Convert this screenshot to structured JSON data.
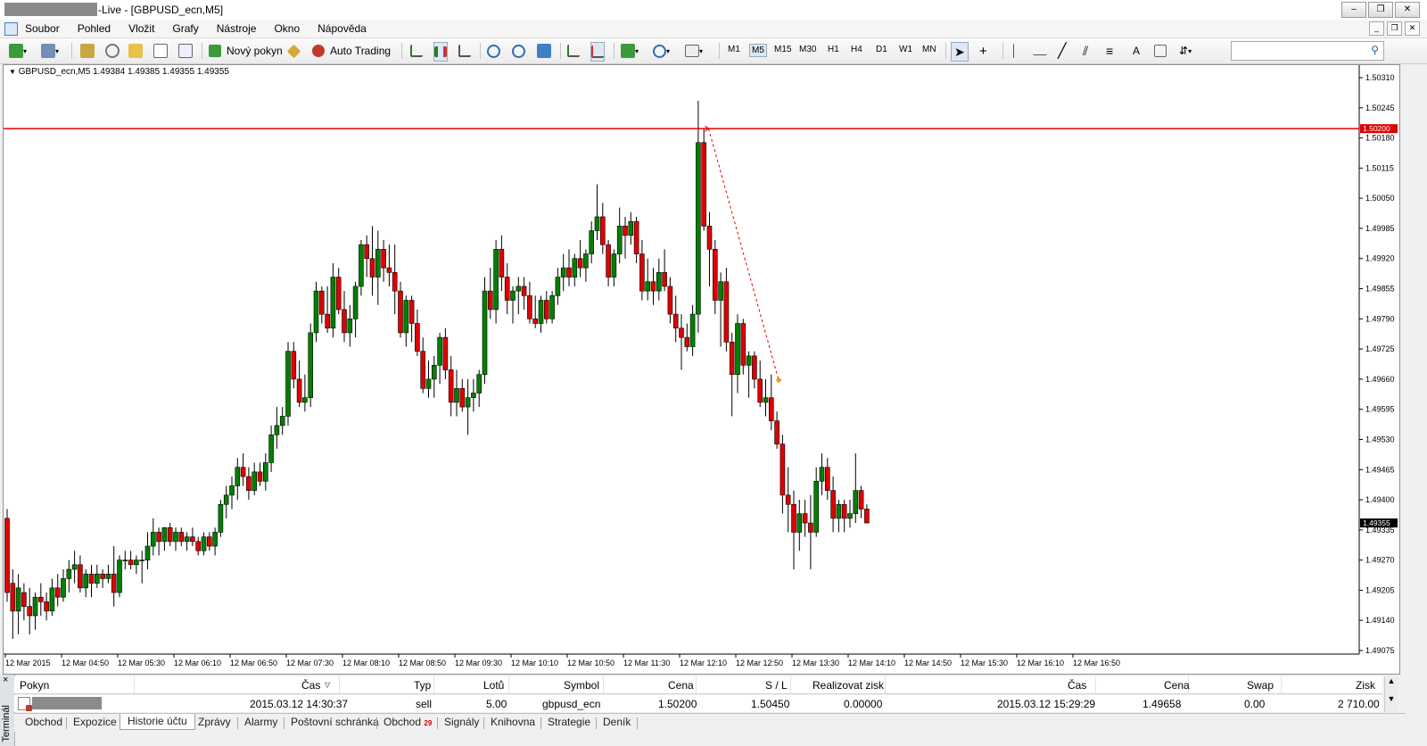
{
  "window": {
    "title_suffix": "-Live - [GBPUSD_ecn,M5]",
    "buttons": [
      "–",
      "❐",
      "✕"
    ]
  },
  "menu": {
    "items": [
      "Soubor",
      "Pohled",
      "Vložit",
      "Grafy",
      "Nástroje",
      "Okno",
      "Nápověda"
    ],
    "mdi_buttons": [
      "_",
      "❐",
      "✕"
    ]
  },
  "toolbar": {
    "new_order": "Nový pokyn",
    "auto_trading": "Auto Trading",
    "timeframes": [
      "M1",
      "M5",
      "M15",
      "M30",
      "H1",
      "H4",
      "D1",
      "W1",
      "MN"
    ],
    "active_timeframe": "M5",
    "search_placeholder": ""
  },
  "chart": {
    "header": "GBPUSD_ecn,M5  1.49384 1.49385 1.49355 1.49355",
    "hline_label": "1.50200",
    "bid_label": "1.49355",
    "colors": {
      "bull": "#008000",
      "bear": "#e00000",
      "line": "#e00000"
    },
    "price_ticks": [
      "1.50310",
      "1.50245",
      "1.50180",
      "1.50115",
      "1.50050",
      "1.49985",
      "1.49920",
      "1.49855",
      "1.49790",
      "1.49725",
      "1.49660",
      "1.49595",
      "1.49530",
      "1.49465",
      "1.49400",
      "1.49335",
      "1.49270",
      "1.49205",
      "1.49140",
      "1.49075"
    ],
    "time_ticks": [
      "12 Mar 2015",
      "12 Mar 04:50",
      "12 Mar 05:30",
      "12 Mar 06:10",
      "12 Mar 06:50",
      "12 Mar 07:30",
      "12 Mar 08:10",
      "12 Mar 08:50",
      "12 Mar 09:30",
      "12 Mar 10:10",
      "12 Mar 10:50",
      "12 Mar 11:30",
      "12 Mar 12:10",
      "12 Mar 12:50",
      "12 Mar 13:30",
      "12 Mar 14:10",
      "12 Mar 14:50",
      "12 Mar 15:30",
      "12 Mar 16:10",
      "12 Mar 16:50"
    ]
  },
  "chart_data": {
    "type": "candlestick",
    "symbol": "GBPUSD_ecn",
    "timeframe": "M5",
    "ylim": [
      1.49075,
      1.5031
    ],
    "horizontal_line": 1.502,
    "trade": {
      "open_price": 1.502,
      "close_price": 1.49658,
      "open_time": "2015.03.12 14:30:37",
      "close_time": "2015.03.12 15:29:29"
    },
    "ohlc": [
      [
        1.4936,
        1.4938,
        1.4918,
        1.492
      ],
      [
        1.4922,
        1.4925,
        1.491,
        1.4916
      ],
      [
        1.4916,
        1.4924,
        1.4911,
        1.4921
      ],
      [
        1.492,
        1.4922,
        1.4914,
        1.4917
      ],
      [
        1.4917,
        1.4921,
        1.4911,
        1.4915
      ],
      [
        1.4915,
        1.492,
        1.4912,
        1.4919
      ],
      [
        1.4919,
        1.4922,
        1.4915,
        1.4918
      ],
      [
        1.4918,
        1.492,
        1.4914,
        1.4916
      ],
      [
        1.4916,
        1.4923,
        1.4915,
        1.4921
      ],
      [
        1.4921,
        1.4924,
        1.4917,
        1.4919
      ],
      [
        1.4919,
        1.4925,
        1.4918,
        1.4923
      ],
      [
        1.4923,
        1.4927,
        1.492,
        1.4925
      ],
      [
        1.4925,
        1.4929,
        1.4922,
        1.4926
      ],
      [
        1.4926,
        1.4928,
        1.492,
        1.4921
      ],
      [
        1.4921,
        1.4925,
        1.4919,
        1.4924
      ],
      [
        1.4924,
        1.4926,
        1.4919,
        1.4922
      ],
      [
        1.4922,
        1.4926,
        1.4921,
        1.4924
      ],
      [
        1.4924,
        1.4925,
        1.4921,
        1.4923
      ],
      [
        1.4923,
        1.4926,
        1.4922,
        1.4924
      ],
      [
        1.4924,
        1.493,
        1.4917,
        1.492
      ],
      [
        1.492,
        1.4928,
        1.4919,
        1.4927
      ],
      [
        1.4927,
        1.4929,
        1.4925,
        1.4927
      ],
      [
        1.4927,
        1.4929,
        1.4925,
        1.4926
      ],
      [
        1.4926,
        1.4928,
        1.4924,
        1.4927
      ],
      [
        1.4927,
        1.4929,
        1.4922,
        1.4927
      ],
      [
        1.4927,
        1.4933,
        1.4925,
        1.493
      ],
      [
        1.493,
        1.4936,
        1.4928,
        1.4933
      ],
      [
        1.4933,
        1.4934,
        1.4928,
        1.4931
      ],
      [
        1.4931,
        1.4934,
        1.4929,
        1.4934
      ],
      [
        1.4934,
        1.4935,
        1.493,
        1.4931
      ],
      [
        1.4931,
        1.4934,
        1.4929,
        1.4933
      ],
      [
        1.4933,
        1.4934,
        1.493,
        1.4931
      ],
      [
        1.4931,
        1.4933,
        1.4929,
        1.4932
      ],
      [
        1.4932,
        1.4934,
        1.493,
        1.4931
      ],
      [
        1.4931,
        1.4932,
        1.4928,
        1.4929
      ],
      [
        1.4929,
        1.4933,
        1.4928,
        1.4932
      ],
      [
        1.4932,
        1.4933,
        1.4929,
        1.493
      ],
      [
        1.493,
        1.4934,
        1.4928,
        1.4933
      ],
      [
        1.4933,
        1.494,
        1.4932,
        1.4939
      ],
      [
        1.4939,
        1.4943,
        1.4936,
        1.4941
      ],
      [
        1.4941,
        1.4945,
        1.4938,
        1.4943
      ],
      [
        1.4943,
        1.4949,
        1.494,
        1.4947
      ],
      [
        1.4947,
        1.495,
        1.4943,
        1.4945
      ],
      [
        1.4945,
        1.4947,
        1.494,
        1.4942
      ],
      [
        1.4942,
        1.4948,
        1.4941,
        1.4946
      ],
      [
        1.4946,
        1.4948,
        1.4943,
        1.4944
      ],
      [
        1.4944,
        1.495,
        1.4942,
        1.4948
      ],
      [
        1.4948,
        1.4956,
        1.4946,
        1.4954
      ],
      [
        1.4954,
        1.496,
        1.4951,
        1.4956
      ],
      [
        1.4956,
        1.496,
        1.4954,
        1.4958
      ],
      [
        1.4958,
        1.4974,
        1.4956,
        1.4972
      ],
      [
        1.4972,
        1.4974,
        1.4964,
        1.4966
      ],
      [
        1.4966,
        1.497,
        1.496,
        1.4961
      ],
      [
        1.4961,
        1.4967,
        1.4959,
        1.4962
      ],
      [
        1.4962,
        1.4978,
        1.496,
        1.4976
      ],
      [
        1.4976,
        1.4987,
        1.4974,
        1.4985
      ],
      [
        1.4985,
        1.4986,
        1.4978,
        1.498
      ],
      [
        1.498,
        1.4986,
        1.4976,
        1.4977
      ],
      [
        1.4977,
        1.4991,
        1.4975,
        1.4988
      ],
      [
        1.4988,
        1.499,
        1.498,
        1.4981
      ],
      [
        1.4981,
        1.4985,
        1.4974,
        1.4976
      ],
      [
        1.4976,
        1.4982,
        1.4973,
        1.4979
      ],
      [
        1.4979,
        1.4987,
        1.4975,
        1.4986
      ],
      [
        1.4986,
        1.4996,
        1.4984,
        1.4995
      ],
      [
        1.4995,
        1.4997,
        1.4988,
        1.4992
      ],
      [
        1.4992,
        1.4999,
        1.4984,
        1.4988
      ],
      [
        1.4988,
        1.4998,
        1.4982,
        1.4994
      ],
      [
        1.4994,
        1.4996,
        1.4987,
        1.499
      ],
      [
        1.499,
        1.4995,
        1.4986,
        1.4989
      ],
      [
        1.4989,
        1.4995,
        1.498,
        1.4985
      ],
      [
        1.4985,
        1.4987,
        1.4975,
        1.4976
      ],
      [
        1.4976,
        1.4984,
        1.4973,
        1.4983
      ],
      [
        1.4983,
        1.4984,
        1.4974,
        1.4978
      ],
      [
        1.4978,
        1.4981,
        1.4971,
        1.4972
      ],
      [
        1.4972,
        1.4975,
        1.4963,
        1.4964
      ],
      [
        1.4964,
        1.497,
        1.4962,
        1.4966
      ],
      [
        1.4966,
        1.4971,
        1.4962,
        1.4969
      ],
      [
        1.4969,
        1.4976,
        1.4965,
        1.4975
      ],
      [
        1.4975,
        1.4977,
        1.4966,
        1.4968
      ],
      [
        1.4968,
        1.4971,
        1.4958,
        1.4961
      ],
      [
        1.4961,
        1.4968,
        1.4958,
        1.4964
      ],
      [
        1.4964,
        1.4966,
        1.4959,
        1.496
      ],
      [
        1.496,
        1.4966,
        1.4954,
        1.4962
      ],
      [
        1.4962,
        1.4966,
        1.4959,
        1.4963
      ],
      [
        1.4963,
        1.4968,
        1.496,
        1.4967
      ],
      [
        1.4967,
        1.4988,
        1.4965,
        1.4985
      ],
      [
        1.4985,
        1.499,
        1.4979,
        1.4981
      ],
      [
        1.4981,
        1.4996,
        1.4978,
        1.4994
      ],
      [
        1.4994,
        1.4997,
        1.4985,
        1.4988
      ],
      [
        1.4988,
        1.4991,
        1.498,
        1.4983
      ],
      [
        1.4983,
        1.4986,
        1.4978,
        1.4985
      ],
      [
        1.4985,
        1.4988,
        1.498,
        1.4986
      ],
      [
        1.4986,
        1.4988,
        1.4981,
        1.4984
      ],
      [
        1.4984,
        1.4987,
        1.4978,
        1.4979
      ],
      [
        1.4979,
        1.4984,
        1.4977,
        1.4978
      ],
      [
        1.4978,
        1.4984,
        1.4976,
        1.4983
      ],
      [
        1.4983,
        1.4985,
        1.4978,
        1.4979
      ],
      [
        1.4979,
        1.4985,
        1.4978,
        1.4984
      ],
      [
        1.4984,
        1.499,
        1.4982,
        1.4988
      ],
      [
        1.4988,
        1.4993,
        1.4985,
        1.499
      ],
      [
        1.499,
        1.4994,
        1.4986,
        1.4988
      ],
      [
        1.4988,
        1.4993,
        1.4986,
        1.4992
      ],
      [
        1.4992,
        1.4996,
        1.4988,
        1.499
      ],
      [
        1.499,
        1.4994,
        1.4987,
        1.4993
      ],
      [
        1.4993,
        1.5,
        1.4991,
        1.4998
      ],
      [
        1.4998,
        1.5008,
        1.4996,
        1.5001
      ],
      [
        1.5001,
        1.5004,
        1.4993,
        1.4995
      ],
      [
        1.4995,
        1.4996,
        1.4986,
        1.4988
      ],
      [
        1.4988,
        1.4994,
        1.4986,
        1.4993
      ],
      [
        1.4993,
        1.5003,
        1.4991,
        1.4999
      ],
      [
        1.4999,
        1.5001,
        1.4992,
        1.4997
      ],
      [
        1.4997,
        1.5002,
        1.4995,
        1.5
      ],
      [
        1.5,
        1.5001,
        1.4991,
        1.4993
      ],
      [
        1.4993,
        1.4996,
        1.4983,
        1.4985
      ],
      [
        1.4985,
        1.4992,
        1.4983,
        1.4987
      ],
      [
        1.4987,
        1.499,
        1.4982,
        1.4985
      ],
      [
        1.4985,
        1.4992,
        1.4983,
        1.4989
      ],
      [
        1.4989,
        1.4994,
        1.4985,
        1.4986
      ],
      [
        1.4986,
        1.4988,
        1.4978,
        1.498
      ],
      [
        1.498,
        1.4984,
        1.4974,
        1.4977
      ],
      [
        1.4977,
        1.498,
        1.4968,
        1.4975
      ],
      [
        1.4975,
        1.4978,
        1.4972,
        1.4973
      ],
      [
        1.4973,
        1.4982,
        1.4971,
        1.498
      ],
      [
        1.498,
        1.5026,
        1.4976,
        1.5017
      ],
      [
        1.5017,
        1.502,
        1.4998,
        1.4999
      ],
      [
        1.4999,
        1.5002,
        1.4986,
        1.4994
      ],
      [
        1.4994,
        1.4996,
        1.498,
        1.4983
      ],
      [
        1.4983,
        1.4989,
        1.4973,
        1.4987
      ],
      [
        1.4987,
        1.499,
        1.4972,
        1.4974
      ],
      [
        1.4974,
        1.4976,
        1.4958,
        1.4967
      ],
      [
        1.4967,
        1.498,
        1.4963,
        1.4978
      ],
      [
        1.4978,
        1.4979,
        1.4967,
        1.4969
      ],
      [
        1.4969,
        1.4972,
        1.4962,
        1.4971
      ],
      [
        1.4971,
        1.4972,
        1.4964,
        1.4966
      ],
      [
        1.4966,
        1.497,
        1.496,
        1.4961
      ],
      [
        1.4961,
        1.4966,
        1.4958,
        1.4962
      ],
      [
        1.4962,
        1.4967,
        1.4955,
        1.4957
      ],
      [
        1.4957,
        1.4959,
        1.4951,
        1.4952
      ],
      [
        1.4952,
        1.4954,
        1.4937,
        1.4941
      ],
      [
        1.4941,
        1.4947,
        1.4933,
        1.4939
      ],
      [
        1.4939,
        1.4942,
        1.4925,
        1.4933
      ],
      [
        1.4933,
        1.494,
        1.4929,
        1.4937
      ],
      [
        1.4937,
        1.494,
        1.4932,
        1.4935
      ],
      [
        1.4935,
        1.4941,
        1.4925,
        1.4933
      ],
      [
        1.4933,
        1.4947,
        1.4932,
        1.4944
      ],
      [
        1.4944,
        1.495,
        1.4941,
        1.4947
      ],
      [
        1.4947,
        1.4949,
        1.494,
        1.4942
      ],
      [
        1.4942,
        1.4945,
        1.4933,
        1.4936
      ],
      [
        1.4936,
        1.494,
        1.4933,
        1.4939
      ],
      [
        1.4939,
        1.494,
        1.4933,
        1.4936
      ],
      [
        1.4936,
        1.494,
        1.4934,
        1.4937
      ],
      [
        1.4937,
        1.495,
        1.4935,
        1.4942
      ],
      [
        1.4942,
        1.4943,
        1.4936,
        1.4938
      ],
      [
        1.4938,
        1.4939,
        1.4935,
        1.4935
      ]
    ]
  },
  "terminal": {
    "side_label": "Terminál",
    "close": "×",
    "columns": [
      "Pokyn",
      "Čas",
      "Typ",
      "Lotů",
      "Symbol",
      "Cena",
      "S / L",
      "Realizovat zisk",
      "Čas",
      "Cena",
      "Swap",
      "Zisk"
    ],
    "row": [
      "",
      "2015.03.12 14:30:37",
      "sell",
      "5.00",
      "gbpusd_ecn",
      "1.50200",
      "1.50450",
      "0.00000",
      "2015.03.12 15:29:29",
      "1.49658",
      "0.00",
      "2 710.00"
    ],
    "tabs": [
      "Obchod",
      "Expozice",
      "Historie účtu",
      "Zprávy",
      "Alarmy",
      "Poštovní schránka",
      "Obchod",
      "Signály",
      "Knihovna",
      "Strategie",
      "Deník"
    ],
    "active_tab": "Historie účtu",
    "trade_badge": "29"
  }
}
